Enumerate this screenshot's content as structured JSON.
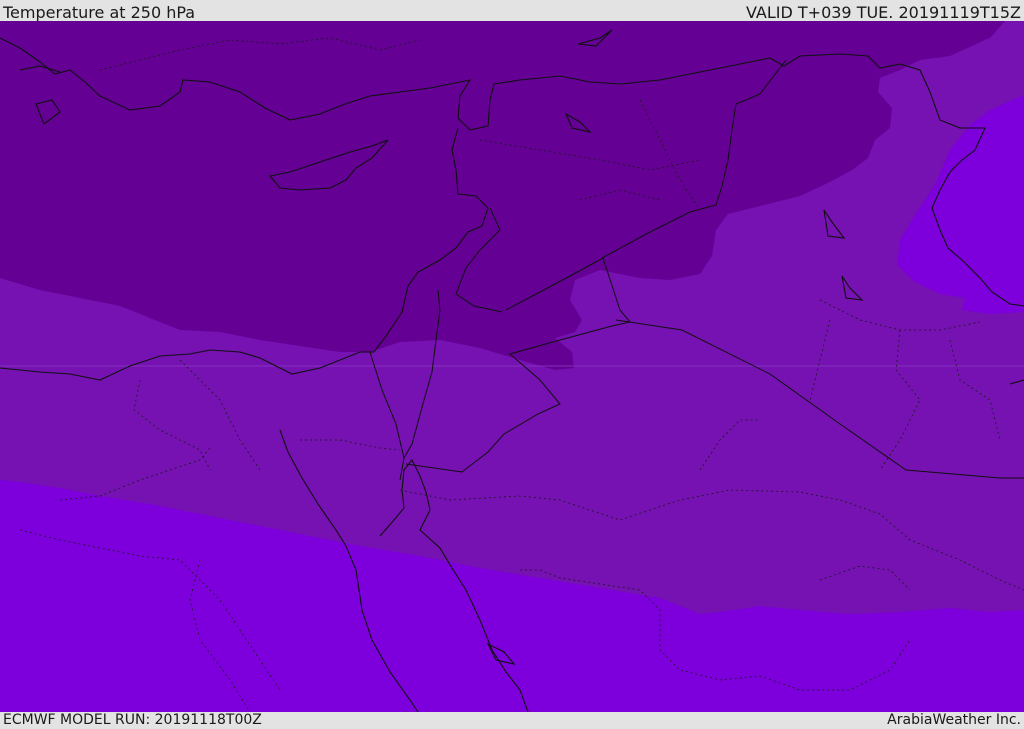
{
  "header": {
    "title": "Temperature at 250 hPa",
    "valid_time": "VALID T+039 TUE. 20191119T15Z"
  },
  "footer": {
    "model_run": "ECMWF MODEL RUN: 20191118T00Z",
    "credit": "ArabiaWeather Inc."
  },
  "colors": {
    "coldest_band": "#650095",
    "middle_band": "#7611b2",
    "warmest_band": "#7d00dc",
    "borders": "#101010",
    "header_background": "#e3e3e3"
  }
}
